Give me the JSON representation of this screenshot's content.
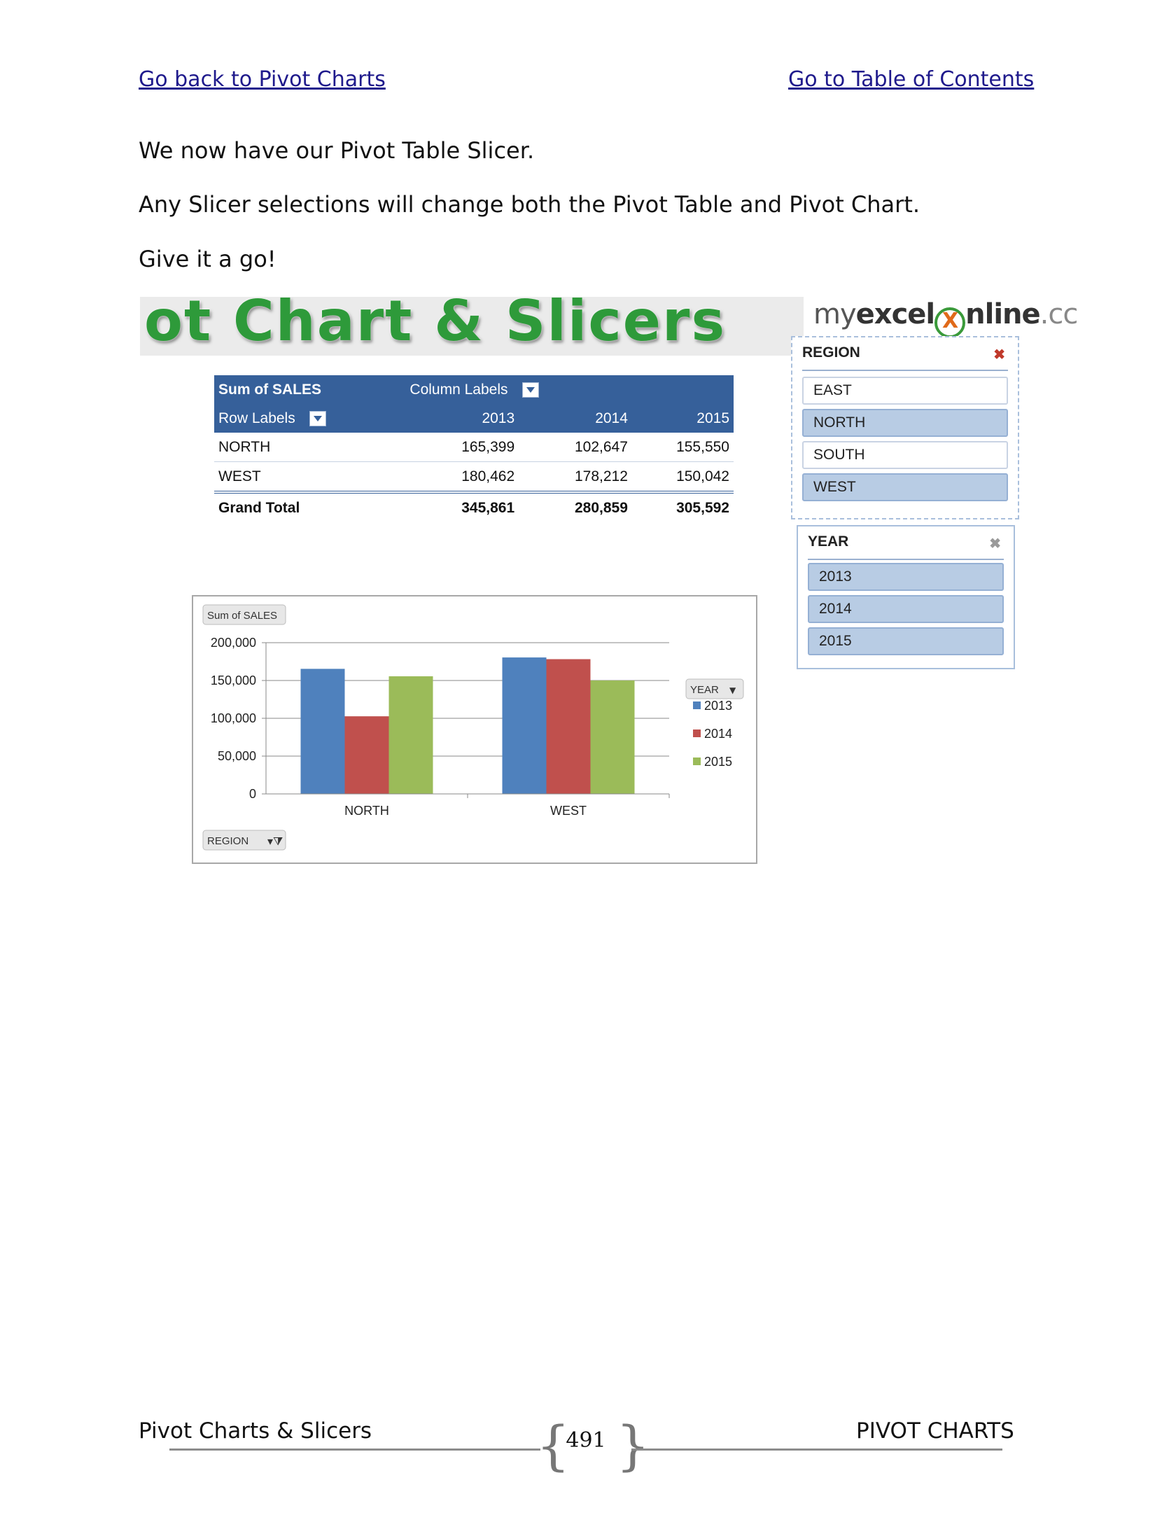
{
  "nav": {
    "back_link": "Go back to Pivot Charts",
    "toc_link": "Go to Table of Contents"
  },
  "body": {
    "para1": "We now have our Pivot Table Slicer.",
    "para2": "Any Slicer selections will change both the Pivot Table and Pivot Chart.",
    "para3": "Give it a go!"
  },
  "banner": {
    "title": "ot Chart & Slicers"
  },
  "logo": {
    "part_my": "my",
    "part_excel": "excel",
    "part_x": "X",
    "part_nline": "nline",
    "part_tld": ".cc"
  },
  "pivot_table": {
    "value_field": "Sum of SALES",
    "column_labels": "Column Labels",
    "row_labels": "Row Labels",
    "years": [
      "2013",
      "2014",
      "2015"
    ],
    "rows": [
      {
        "label": "NORTH",
        "values": [
          "165,399",
          "102,647",
          "155,550"
        ]
      },
      {
        "label": "WEST",
        "values": [
          "180,462",
          "178,212",
          "150,042"
        ]
      }
    ],
    "total": {
      "label": "Grand Total",
      "values": [
        "345,861",
        "280,859",
        "305,592"
      ]
    }
  },
  "slicers": {
    "region": {
      "title": "REGION",
      "items": [
        {
          "label": "EAST",
          "selected": false
        },
        {
          "label": "NORTH",
          "selected": true
        },
        {
          "label": "SOUTH",
          "selected": false
        },
        {
          "label": "WEST",
          "selected": true
        }
      ]
    },
    "year": {
      "title": "YEAR",
      "items": [
        {
          "label": "2013",
          "selected": true
        },
        {
          "label": "2014",
          "selected": true
        },
        {
          "label": "2015",
          "selected": true
        }
      ]
    }
  },
  "chart_data": {
    "type": "bar",
    "value_button": "Sum of SALES",
    "axis_button": "REGION",
    "legend_button": "YEAR",
    "categories": [
      "NORTH",
      "WEST"
    ],
    "series": [
      {
        "name": "2013",
        "values": [
          165399,
          180462
        ],
        "color": "#4f81bd"
      },
      {
        "name": "2014",
        "values": [
          102647,
          178212
        ],
        "color": "#c0504d"
      },
      {
        "name": "2015",
        "values": [
          155550,
          150042
        ],
        "color": "#9bbb59"
      }
    ],
    "ylim": [
      0,
      200000
    ],
    "yticks": [
      "0",
      "50,000",
      "100,000",
      "150,000",
      "200,000"
    ],
    "ytick_values": [
      0,
      50000,
      100000,
      150000,
      200000
    ],
    "grid": true,
    "legend": "right"
  },
  "footer": {
    "left": "Pivot Charts & Slicers",
    "page": "491",
    "right": "PIVOT CHARTS"
  }
}
